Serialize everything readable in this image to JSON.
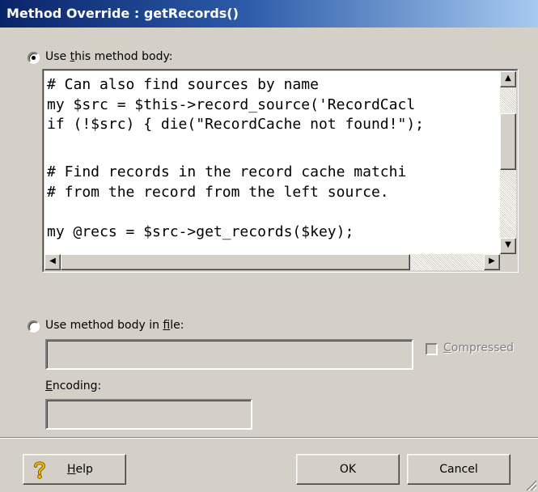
{
  "dialog": {
    "title": "Method Override : getRecords()"
  },
  "body_option": {
    "label_pre": "Use ",
    "label_key": "t",
    "label_post": "his method body:",
    "selected": true,
    "code_lines": [
      "# Can also find sources by name",
      "my $src = $this->record_source('RecordCacl",
      "if (!$src) { die(\"RecordCache not found!\");",
      "",
      "# Find records in the record cache matchi",
      "# from the record from the left source.",
      "",
      "my @recs = $src->get_records($key);"
    ]
  },
  "file_option": {
    "label_pre": "Use method body in ",
    "label_key": "f",
    "label_post": "ile:",
    "selected": false,
    "file_value": "",
    "compressed_key": "C",
    "compressed_post": "ompressed",
    "compressed_checked": false,
    "encoding_key": "E",
    "encoding_post": "ncoding:",
    "encoding_value": ""
  },
  "buttons": {
    "help_icon": "question-mark-icon",
    "help_key": "H",
    "help_post": "elp",
    "ok": "OK",
    "cancel": "Cancel"
  },
  "scrollbars": {
    "up_arrow": "▲",
    "down_arrow": "▼",
    "left_arrow": "◀",
    "right_arrow": "▶"
  }
}
